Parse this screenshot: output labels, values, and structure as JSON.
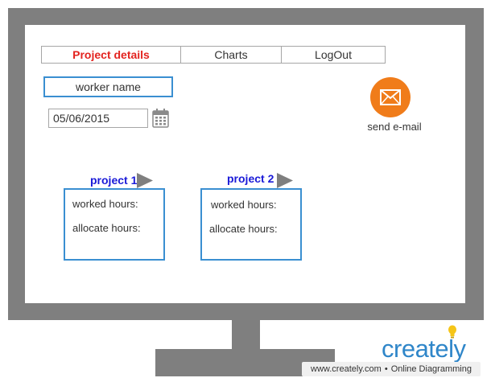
{
  "tabs": [
    {
      "label": "Project details"
    },
    {
      "label": "Charts"
    },
    {
      "label": "LogOut"
    }
  ],
  "form": {
    "worker_name_placeholder": "worker name",
    "date_value": "05/06/2015"
  },
  "email": {
    "label": "send e-mail",
    "color": "#f07c1a"
  },
  "projects": [
    {
      "title": "project 1",
      "worked_label": "worked hours:",
      "allocate_label": "allocate hours:"
    },
    {
      "title": "project 2",
      "worked_label": "worked hours:",
      "allocate_label": "allocate hours:"
    }
  ],
  "branding": {
    "logo_text": "creately",
    "footer_url": "www.creately.com",
    "footer_separator": "•",
    "footer_tagline": "Online Diagramming"
  },
  "colors": {
    "accent_blue": "#3a8fd1",
    "active_tab_red": "#e3231f",
    "project_title_blue": "#1a1ad8",
    "frame_gray": "#7f7f7f"
  }
}
